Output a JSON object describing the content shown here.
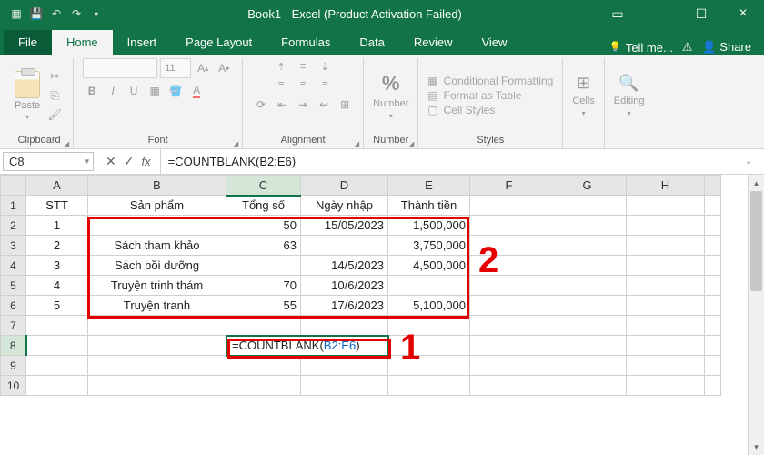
{
  "titlebar": {
    "title": "Book1 - Excel (Product Activation Failed)"
  },
  "tabs": {
    "file": "File",
    "home": "Home",
    "insert": "Insert",
    "page_layout": "Page Layout",
    "formulas": "Formulas",
    "data": "Data",
    "review": "Review",
    "view": "View",
    "tell_me": "Tell me...",
    "share": "Share"
  },
  "ribbon": {
    "paste": "Paste",
    "clipboard": "Clipboard",
    "font_size": "11",
    "font": "Font",
    "alignment": "Alignment",
    "number": "Number",
    "cond_fmt": "Conditional Formatting",
    "fmt_table": "Format as Table",
    "cell_styles": "Cell Styles",
    "styles": "Styles",
    "cells": "Cells",
    "editing": "Editing"
  },
  "formula_bar": {
    "name": "C8",
    "formula": "=COUNTBLANK(B2:E6)"
  },
  "columns": [
    "A",
    "B",
    "C",
    "D",
    "E",
    "F",
    "G",
    "H"
  ],
  "headers": {
    "A": "STT",
    "B": "Sản phẩm",
    "C": "Tổng số",
    "D": "Ngày nhập",
    "E": "Thành tiền"
  },
  "rows": [
    {
      "A": "1",
      "B": "",
      "C": "50",
      "D": "15/05/2023",
      "E": "1,500,000"
    },
    {
      "A": "2",
      "B": "Sách tham khảo",
      "C": "63",
      "D": "",
      "E": "3,750,000"
    },
    {
      "A": "3",
      "B": "Sách bồi dưỡng",
      "C": "",
      "D": "14/5/2023",
      "E": "4,500,000"
    },
    {
      "A": "4",
      "B": "Truyện trinh thám",
      "C": "70",
      "D": "10/6/2023",
      "E": ""
    },
    {
      "A": "5",
      "B": "Truyện tranh",
      "C": "55",
      "D": "17/6/2023",
      "E": "5,100,000"
    }
  ],
  "cell_c8_prefix": "=COUNTBLANK(",
  "cell_c8_range": "B2:E6",
  "cell_c8_suffix": ")",
  "anno": {
    "one": "1",
    "two": "2"
  }
}
